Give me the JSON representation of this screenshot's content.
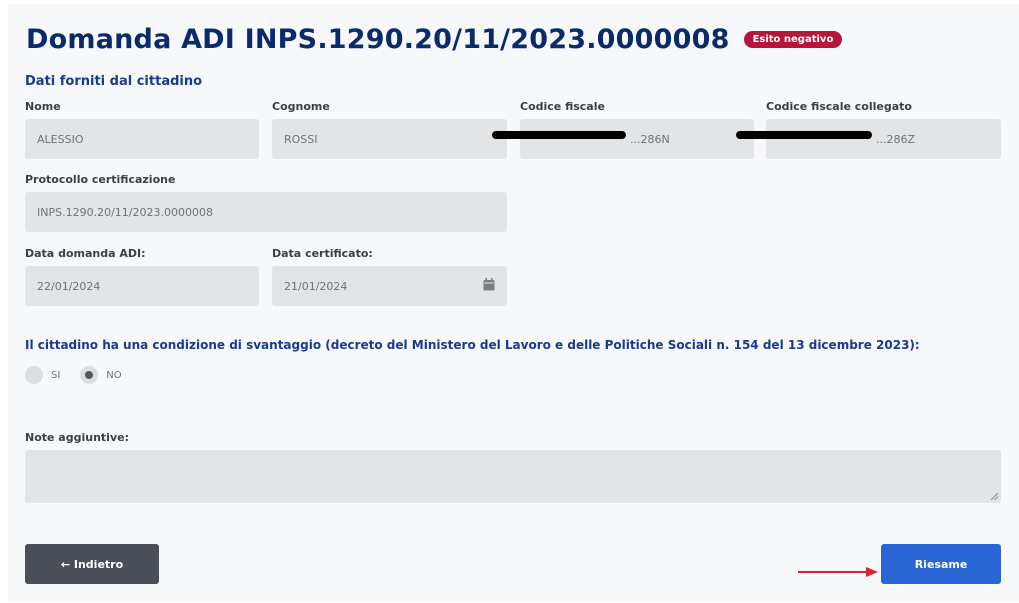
{
  "header": {
    "title": "Domanda ADI INPS.1290.20/11/2023.0000008",
    "status_badge": "Esito negativo",
    "status_color": "#b5173a"
  },
  "section": {
    "title": "Dati forniti dal cittadino"
  },
  "fields": {
    "nome": {
      "label": "Nome",
      "value": "ALESSIO"
    },
    "cognome": {
      "label": "Cognome",
      "value": "ROSSI"
    },
    "codice_fiscale": {
      "label": "Codice fiscale",
      "value": "...286N"
    },
    "codice_fiscale_collegato": {
      "label": "Codice fiscale collegato",
      "value": "...286Z"
    },
    "protocollo": {
      "label": "Protocollo certificazione",
      "value": "INPS.1290.20/11/2023.0000008"
    },
    "data_domanda": {
      "label": "Data domanda ADI:",
      "value": "22/01/2024"
    },
    "data_certificato": {
      "label": "Data certificato:",
      "value": "21/01/2024"
    }
  },
  "svantaggio": {
    "question": "Il cittadino ha una condizione di svantaggio (decreto del Ministero del Lavoro e delle Politiche Sociali n. 154 del 13 dicembre 2023):",
    "options": [
      {
        "label": "SI",
        "selected": false
      },
      {
        "label": "NO",
        "selected": true
      }
    ]
  },
  "note": {
    "label": "Note aggiuntive:",
    "value": ""
  },
  "buttons": {
    "back": "← Indietro",
    "review": "Riesame"
  },
  "colors": {
    "primary": "#2966d4",
    "heading": "#0b2a6b",
    "annotation_arrow": "#d9232e"
  }
}
